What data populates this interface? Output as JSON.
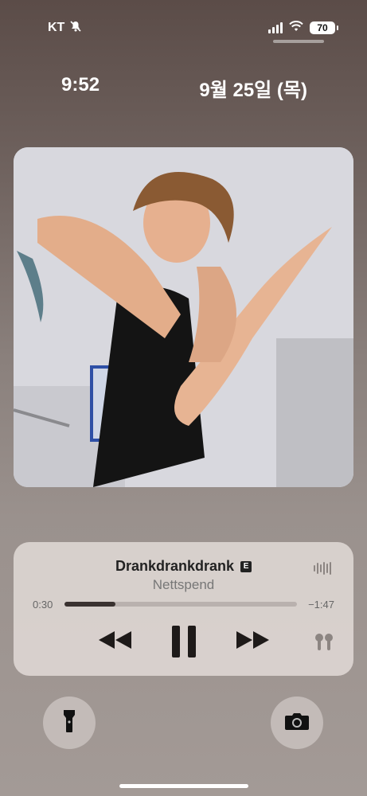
{
  "status_bar": {
    "carrier": "KT",
    "battery": "70"
  },
  "lock": {
    "time": "9:52",
    "date": "9월 25일 (목)"
  },
  "now_playing": {
    "title": "Drankdrankdrank",
    "explicit": "E",
    "artist": "Nettspend",
    "elapsed": "0:30",
    "remaining": "−1:47",
    "progress": 0.22
  },
  "icons": {
    "mute": "bell-slash-icon",
    "signal": "signal-bars-icon",
    "wifi": "wifi-icon",
    "waveform": "waveform-icon",
    "rewind": "rewind-icon",
    "pause": "pause-icon",
    "forward": "fast-forward-icon",
    "output": "airpods-icon",
    "flashlight": "flashlight-icon",
    "camera": "camera-icon"
  }
}
